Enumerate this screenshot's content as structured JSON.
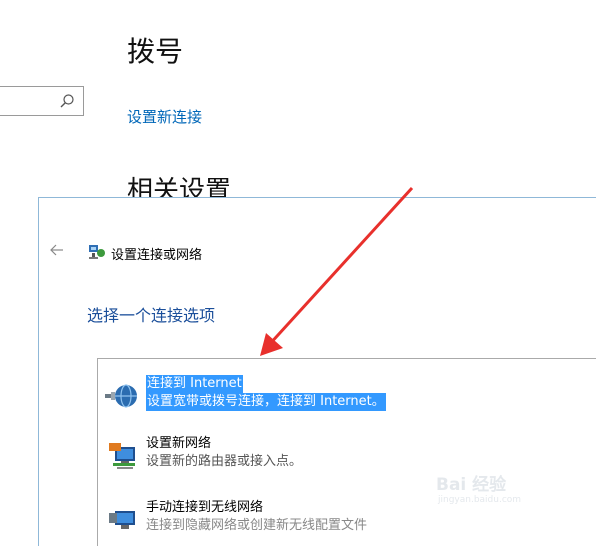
{
  "background_page": {
    "title": "拨号",
    "new_connection_link": "设置新连接",
    "related_settings_heading": "相关设置"
  },
  "dialog": {
    "title": "设置连接或网络",
    "subtitle": "选择一个连接选项",
    "options": [
      {
        "label": "连接到 Internet",
        "description": "设置宽带或拨号连接，连接到 Internet。",
        "selected": true
      },
      {
        "label": "设置新网络",
        "description": "设置新的路由器或接入点。",
        "selected": false
      },
      {
        "label": "手动连接到无线网络",
        "description": "连接到隐藏网络或创建新无线配置文件",
        "selected": false
      }
    ]
  },
  "watermark": {
    "text": "Bai 经验",
    "url": "jingyan.baidu.com"
  },
  "colors": {
    "link": "#0067b8",
    "selection": "#3399ff",
    "subtitle": "#1a4e9a",
    "annotation_arrow": "#e8302c"
  },
  "icons": [
    "search-icon",
    "back-arrow-icon",
    "network-setup-icon",
    "globe-connect-icon",
    "new-network-icon",
    "wireless-manual-icon"
  ]
}
